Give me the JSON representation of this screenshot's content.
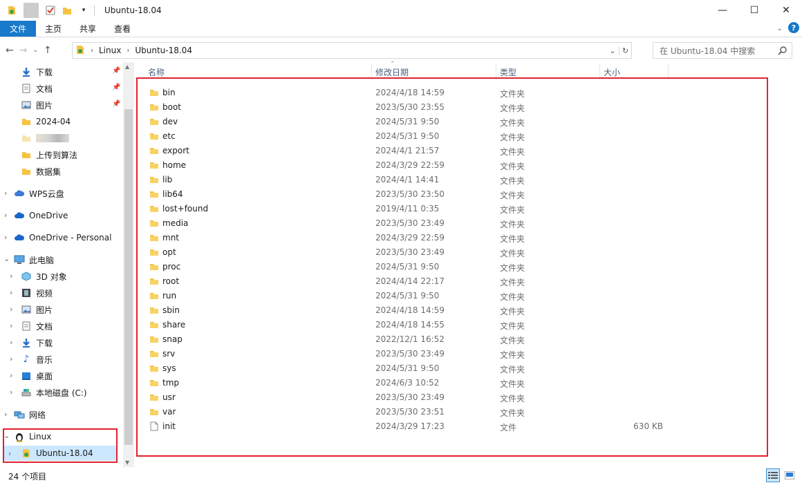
{
  "window": {
    "title": "Ubuntu-18.04",
    "minimize": "—",
    "maximize": "☐",
    "close": "✕"
  },
  "ribbon": {
    "tabs": [
      "文件",
      "主页",
      "共享",
      "查看"
    ],
    "help": "?"
  },
  "address": {
    "crumbs": [
      "Linux",
      "Ubuntu-18.04"
    ],
    "search_placeholder": "在 Ubuntu-18.04 中搜索"
  },
  "nav_pane": {
    "quick_access": [
      {
        "label": "下载",
        "icon": "download-arrow-icon",
        "pinned": true
      },
      {
        "label": "文档",
        "icon": "document-icon",
        "pinned": true
      },
      {
        "label": "图片",
        "icon": "picture-icon",
        "pinned": true
      },
      {
        "label": "2024-04",
        "icon": "folder-icon",
        "pinned": false
      },
      {
        "label": "",
        "icon": "folder-icon",
        "pinned": false,
        "blurred": true
      },
      {
        "label": "上传到算法",
        "icon": "folder-icon",
        "pinned": false
      },
      {
        "label": "数据集",
        "icon": "folder-icon",
        "pinned": false
      }
    ],
    "roots": [
      {
        "label": "WPS云盘",
        "icon": "wps-cloud-icon"
      },
      {
        "label": "OneDrive",
        "icon": "onedrive-cloud-icon"
      },
      {
        "label": "OneDrive - Personal",
        "icon": "onedrive-cloud-icon"
      }
    ],
    "this_pc": {
      "label": "此电脑",
      "children": [
        {
          "label": "3D 对象",
          "icon": "3d-objects-icon"
        },
        {
          "label": "视频",
          "icon": "video-icon"
        },
        {
          "label": "图片",
          "icon": "picture-icon"
        },
        {
          "label": "文档",
          "icon": "document-icon"
        },
        {
          "label": "下载",
          "icon": "download-arrow-icon"
        },
        {
          "label": "音乐",
          "icon": "music-note-icon"
        },
        {
          "label": "桌面",
          "icon": "desktop-icon"
        },
        {
          "label": "本地磁盘 (C:)",
          "icon": "local-disk-icon"
        }
      ]
    },
    "network": "网络",
    "linux": "Linux",
    "linux_child": "Ubuntu-18.04"
  },
  "columns": {
    "name": "名称",
    "modified": "修改日期",
    "type": "类型",
    "size": "大小"
  },
  "files": [
    {
      "name": "bin",
      "modified": "2024/4/18 14:59",
      "type": "文件夹",
      "size": "",
      "kind": "folder"
    },
    {
      "name": "boot",
      "modified": "2023/5/30 23:55",
      "type": "文件夹",
      "size": "",
      "kind": "folder"
    },
    {
      "name": "dev",
      "modified": "2024/5/31 9:50",
      "type": "文件夹",
      "size": "",
      "kind": "folder"
    },
    {
      "name": "etc",
      "modified": "2024/5/31 9:50",
      "type": "文件夹",
      "size": "",
      "kind": "folder"
    },
    {
      "name": "export",
      "modified": "2024/4/1 21:57",
      "type": "文件夹",
      "size": "",
      "kind": "folder"
    },
    {
      "name": "home",
      "modified": "2024/3/29 22:59",
      "type": "文件夹",
      "size": "",
      "kind": "folder"
    },
    {
      "name": "lib",
      "modified": "2024/4/1 14:41",
      "type": "文件夹",
      "size": "",
      "kind": "folder"
    },
    {
      "name": "lib64",
      "modified": "2023/5/30 23:50",
      "type": "文件夹",
      "size": "",
      "kind": "folder"
    },
    {
      "name": "lost+found",
      "modified": "2019/4/11 0:35",
      "type": "文件夹",
      "size": "",
      "kind": "folder"
    },
    {
      "name": "media",
      "modified": "2023/5/30 23:49",
      "type": "文件夹",
      "size": "",
      "kind": "folder"
    },
    {
      "name": "mnt",
      "modified": "2024/3/29 22:59",
      "type": "文件夹",
      "size": "",
      "kind": "folder"
    },
    {
      "name": "opt",
      "modified": "2023/5/30 23:49",
      "type": "文件夹",
      "size": "",
      "kind": "folder"
    },
    {
      "name": "proc",
      "modified": "2024/5/31 9:50",
      "type": "文件夹",
      "size": "",
      "kind": "folder"
    },
    {
      "name": "root",
      "modified": "2024/4/14 22:17",
      "type": "文件夹",
      "size": "",
      "kind": "folder"
    },
    {
      "name": "run",
      "modified": "2024/5/31 9:50",
      "type": "文件夹",
      "size": "",
      "kind": "folder"
    },
    {
      "name": "sbin",
      "modified": "2024/4/18 14:59",
      "type": "文件夹",
      "size": "",
      "kind": "folder"
    },
    {
      "name": "share",
      "modified": "2024/4/18 14:55",
      "type": "文件夹",
      "size": "",
      "kind": "folder"
    },
    {
      "name": "snap",
      "modified": "2022/12/1 16:52",
      "type": "文件夹",
      "size": "",
      "kind": "folder"
    },
    {
      "name": "srv",
      "modified": "2023/5/30 23:49",
      "type": "文件夹",
      "size": "",
      "kind": "folder"
    },
    {
      "name": "sys",
      "modified": "2024/5/31 9:50",
      "type": "文件夹",
      "size": "",
      "kind": "folder"
    },
    {
      "name": "tmp",
      "modified": "2024/6/3 10:52",
      "type": "文件夹",
      "size": "",
      "kind": "folder"
    },
    {
      "name": "usr",
      "modified": "2023/5/30 23:49",
      "type": "文件夹",
      "size": "",
      "kind": "folder"
    },
    {
      "name": "var",
      "modified": "2023/5/30 23:51",
      "type": "文件夹",
      "size": "",
      "kind": "folder"
    },
    {
      "name": "init",
      "modified": "2024/3/29 17:23",
      "type": "文件",
      "size": "630 KB",
      "kind": "file"
    }
  ],
  "status": {
    "item_count": "24 个项目"
  },
  "colors": {
    "accent": "#1979ca",
    "highlight_box": "#e0212f",
    "folder": "#f5c342",
    "selection": "#cce8ff"
  }
}
